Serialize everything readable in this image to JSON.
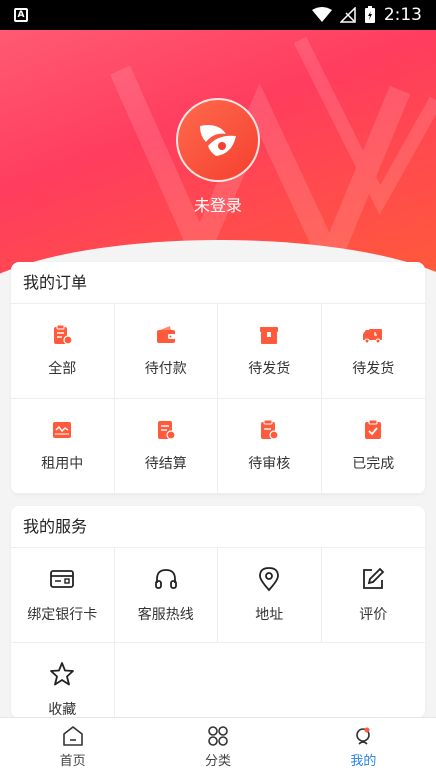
{
  "status_bar": {
    "time": "2:13"
  },
  "profile": {
    "login_text": "未登录"
  },
  "orders": {
    "title": "我的订单",
    "items": [
      {
        "label": "全部",
        "icon": "all-orders-icon"
      },
      {
        "label": "待付款",
        "icon": "wallet-icon"
      },
      {
        "label": "待发货",
        "icon": "box-icon"
      },
      {
        "label": "待发货",
        "icon": "truck-icon"
      },
      {
        "label": "租用中",
        "icon": "renting-icon"
      },
      {
        "label": "待结算",
        "icon": "settlement-icon"
      },
      {
        "label": "待审核",
        "icon": "review-icon"
      },
      {
        "label": "已完成",
        "icon": "completed-icon"
      }
    ]
  },
  "services": {
    "title": "我的服务",
    "items": [
      {
        "label": "绑定银行卡",
        "icon": "bank-card-icon"
      },
      {
        "label": "客服热线",
        "icon": "headphones-icon"
      },
      {
        "label": "地址",
        "icon": "location-icon"
      },
      {
        "label": "评价",
        "icon": "edit-icon"
      },
      {
        "label": "收藏",
        "icon": "star-icon"
      }
    ]
  },
  "tabbar": {
    "items": [
      {
        "label": "首页",
        "icon": "home-icon",
        "active": false
      },
      {
        "label": "分类",
        "icon": "category-icon",
        "active": false
      },
      {
        "label": "我的",
        "icon": "profile-icon",
        "active": true
      }
    ]
  },
  "colors": {
    "accent": "#ff4562",
    "icon_orange": "#ff5a3c",
    "tab_active": "#2b85e4"
  }
}
